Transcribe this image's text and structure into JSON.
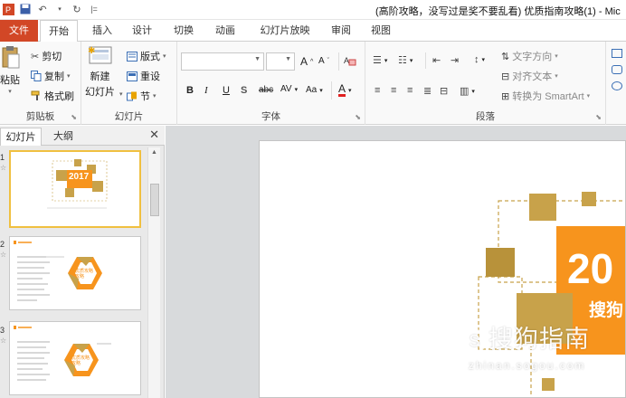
{
  "window": {
    "title": "(高阶攻略，没写过是奖不要乱看) 优质指南攻略(1) - Mic",
    "qat_icons": [
      "ppt-logo-icon",
      "save-icon",
      "undo-icon",
      "redo-icon",
      "customize-qat-icon"
    ]
  },
  "tabs": [
    "文件",
    "开始",
    "插入",
    "设计",
    "切换",
    "动画",
    "幻灯片放映",
    "审阅",
    "视图"
  ],
  "ribbon": {
    "clipboard": {
      "label": "剪贴板",
      "paste": "粘贴",
      "cut": "剪切",
      "copy": "复制",
      "format_painter": "格式刷"
    },
    "slides": {
      "label": "幻灯片",
      "new_slide": "新建",
      "new_slide_2": "幻灯片",
      "layout": "版式",
      "reset": "重设",
      "section": "节"
    },
    "font": {
      "label": "字体",
      "font_name": "",
      "font_size": "",
      "bold": "B",
      "italic": "I",
      "underline": "U",
      "shadow": "S",
      "strike": "abc",
      "char_spacing": "AV",
      "change_case": "Aa",
      "font_color": "A",
      "grow": "A",
      "shrink": "A"
    },
    "paragraph": {
      "label": "段落",
      "text_direction": "文字方向",
      "align_text": "对齐文本",
      "smartart": "转换为 SmartArt"
    }
  },
  "pane": {
    "tab_slides": "幻灯片",
    "tab_outline": "大纲",
    "thumbs": [
      {
        "num": "1",
        "year": "2017",
        "selected": true
      },
      {
        "num": "2",
        "center": "优质攻略\n攻略"
      },
      {
        "num": "3",
        "center": "优质攻略\n攻略"
      }
    ]
  },
  "slide": {
    "big_number": "20",
    "subtitle": "搜狗"
  },
  "watermark": {
    "main": "搜狗指南",
    "url": "zhinan.sogou.com"
  },
  "colors": {
    "file_tab": "#d24726",
    "orange": "#f7941d",
    "gold": "#c8a24a"
  }
}
